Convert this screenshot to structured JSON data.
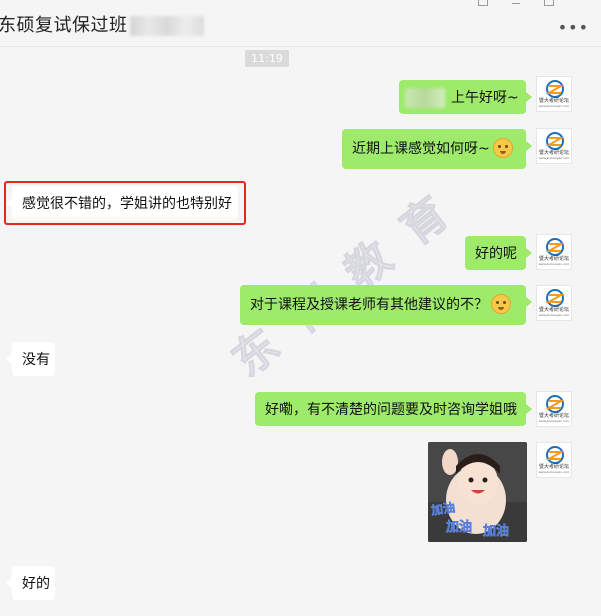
{
  "window": {
    "title": "东硕复试保过班"
  },
  "chat": {
    "timestamp": "11:19"
  },
  "messages": [
    {
      "side": "right",
      "text": "上午好呀~"
    },
    {
      "side": "right",
      "text": "近期上课感觉如何呀~",
      "emoji": "grin-emoji"
    },
    {
      "side": "left",
      "text": "感觉很不错的，学姐讲的也特别好"
    },
    {
      "side": "right",
      "text": "好的呢"
    },
    {
      "side": "right",
      "text": "对于课程及授课老师有其他建议的不？",
      "emoji": "thinking-emoji"
    },
    {
      "side": "left",
      "text": "没有"
    },
    {
      "side": "right",
      "text": "好嘞，有不清楚的问题要及时咨询学姐哦"
    },
    {
      "side": "right",
      "sticker": "girl-cheering-sticker",
      "sticker_text": [
        "加油",
        "加油",
        "加油"
      ]
    },
    {
      "side": "left",
      "text": "好的"
    }
  ],
  "avatar": {
    "label": "暨大考研论坛",
    "sublabel": "www.jnukaoyan.com"
  },
  "watermark": "东 恺 教 育",
  "colors": {
    "sent_bubble": "#9eea6a",
    "received_bubble": "#ffffff",
    "highlight": "#e8261c",
    "background": "#f5f5f5"
  }
}
